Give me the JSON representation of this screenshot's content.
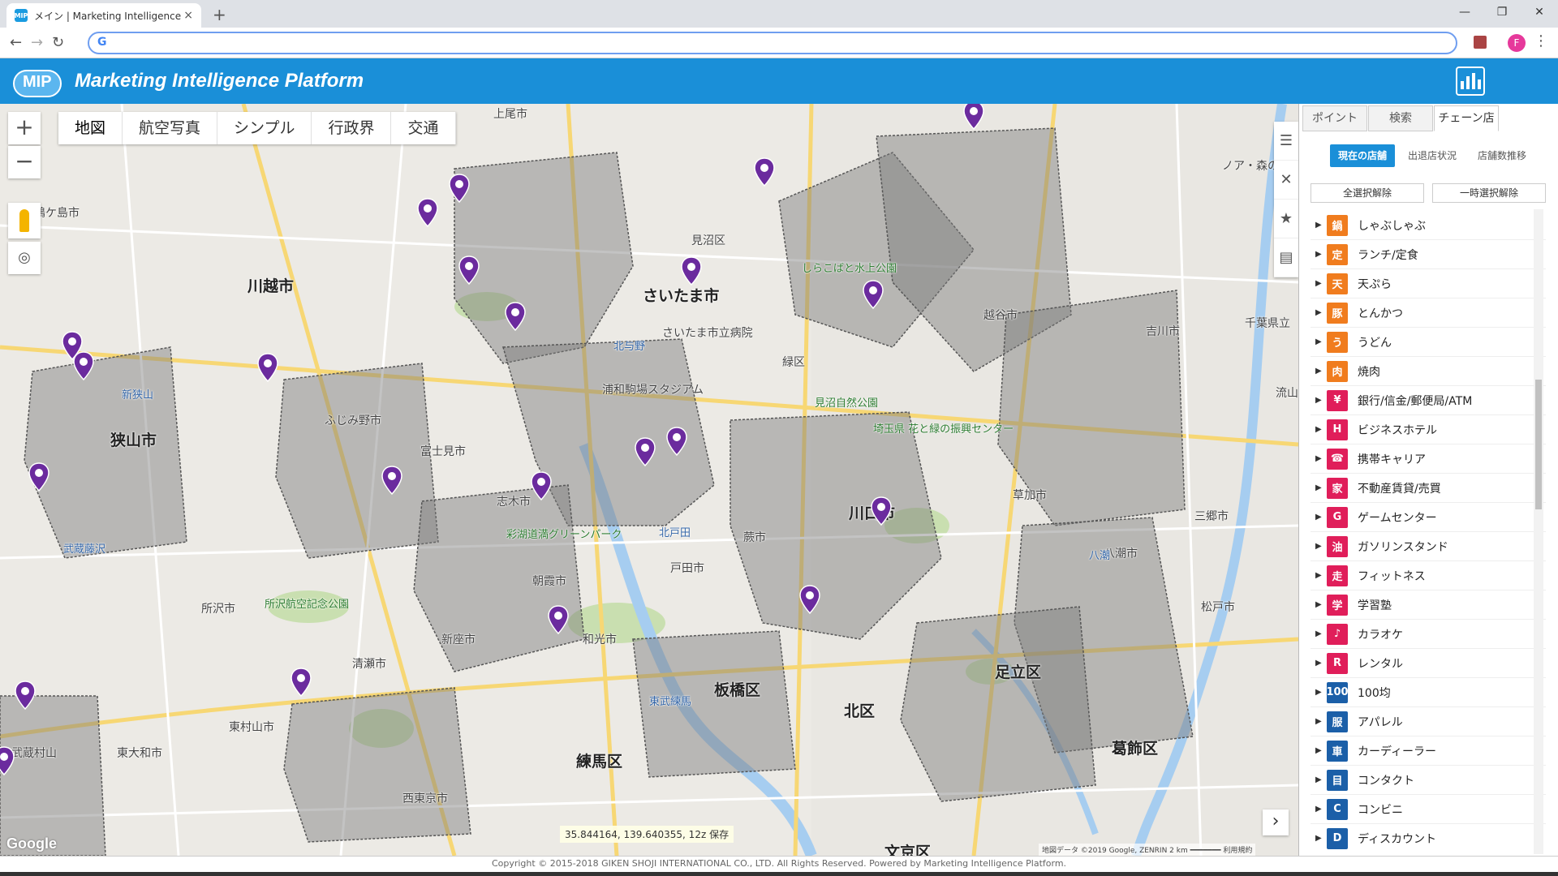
{
  "browser": {
    "tab_title": "メイン | Marketing Intelligence Pla",
    "tab_close": "×",
    "new_tab": "+",
    "window_controls": [
      "—",
      "❐",
      "✕"
    ],
    "omnibox_value": "",
    "avatar_letter": "F"
  },
  "app": {
    "logo_text": "MIP",
    "title": "Marketing Intelligence Platform"
  },
  "map": {
    "map_types": [
      "地図",
      "航空写真",
      "シンプル",
      "行政界",
      "交通"
    ],
    "zoom_in": "+",
    "zoom_out": "−",
    "coordinates": "35.844164, 139.640355, 12z",
    "save_label": "保存",
    "google_logo": "Google",
    "attribution": "地図データ ©2019 Google, ZENRIN   2 km ━━━━━━━   利用規約",
    "place_labels": [
      {
        "t": "上尾市",
        "c": "lbl"
      },
      {
        "t": "さいたま市",
        "c": "lbl big"
      },
      {
        "t": "川越市",
        "c": "lbl big"
      },
      {
        "t": "鶴ケ島市",
        "c": "lbl"
      },
      {
        "t": "狭山市",
        "c": "lbl big"
      },
      {
        "t": "ふじみ野市",
        "c": "lbl"
      },
      {
        "t": "富士見市",
        "c": "lbl"
      },
      {
        "t": "志木市",
        "c": "lbl"
      },
      {
        "t": "朝霞市",
        "c": "lbl"
      },
      {
        "t": "戸田市",
        "c": "lbl"
      },
      {
        "t": "蕨市",
        "c": "lbl"
      },
      {
        "t": "川口市",
        "c": "lbl big"
      },
      {
        "t": "草加市",
        "c": "lbl"
      },
      {
        "t": "越谷市",
        "c": "lbl"
      },
      {
        "t": "吉川市",
        "c": "lbl"
      },
      {
        "t": "三郷市",
        "c": "lbl"
      },
      {
        "t": "八潮市",
        "c": "lbl"
      },
      {
        "t": "足立区",
        "c": "lbl big"
      },
      {
        "t": "葛飾区",
        "c": "lbl big"
      },
      {
        "t": "北区",
        "c": "lbl big"
      },
      {
        "t": "板橋区",
        "c": "lbl big"
      },
      {
        "t": "練馬区",
        "c": "lbl big"
      },
      {
        "t": "和光市",
        "c": "lbl"
      },
      {
        "t": "新座市",
        "c": "lbl"
      },
      {
        "t": "清瀬市",
        "c": "lbl"
      },
      {
        "t": "所沢市",
        "c": "lbl"
      },
      {
        "t": "東村山市",
        "c": "lbl"
      },
      {
        "t": "東大和市",
        "c": "lbl"
      },
      {
        "t": "西東京市",
        "c": "lbl"
      },
      {
        "t": "文京区",
        "c": "lbl big"
      },
      {
        "t": "見沼区",
        "c": "lbl"
      },
      {
        "t": "緑区",
        "c": "lbl"
      },
      {
        "t": "武蔵藤沢",
        "c": "lbl blue"
      },
      {
        "t": "さいたま市立病院",
        "c": "lbl"
      },
      {
        "t": "所沢航空記念公園",
        "c": "lbl park"
      },
      {
        "t": "しらこばと水上公園",
        "c": "lbl park"
      },
      {
        "t": "彩湖道満グリーンパーク",
        "c": "lbl park"
      },
      {
        "t": "埼玉県 花と緑の振興センター",
        "c": "lbl park"
      },
      {
        "t": "見沼自然公園",
        "c": "lbl park"
      },
      {
        "t": "浦和駒場スタジアム",
        "c": "lbl"
      },
      {
        "t": "新狭山",
        "c": "lbl blue"
      },
      {
        "t": "北与野",
        "c": "lbl blue"
      },
      {
        "t": "北戸田",
        "c": "lbl blue"
      },
      {
        "t": "東武練馬",
        "c": "lbl blue"
      },
      {
        "t": "八潮",
        "c": "lbl blue"
      },
      {
        "t": "ノア・森の",
        "c": "lbl"
      },
      {
        "t": "千葉県立",
        "c": "lbl"
      },
      {
        "t": "流山",
        "c": "lbl"
      },
      {
        "t": "松戸市",
        "c": "lbl"
      },
      {
        "t": "武蔵村山",
        "c": "lbl"
      }
    ]
  },
  "sidebar": {
    "tabs": [
      "ポイント",
      "検索",
      "チェーン店"
    ],
    "subtabs": [
      "現在の店舗",
      "出退店状況",
      "店舗数推移"
    ],
    "select_all": "全選択解除",
    "temp_clear": "一時選択解除",
    "categories": [
      {
        "name": "しゃぶしゃぶ",
        "color": "#f07c1e",
        "glyph": "鍋"
      },
      {
        "name": "ランチ/定食",
        "color": "#f07c1e",
        "glyph": "定"
      },
      {
        "name": "天ぷら",
        "color": "#f07c1e",
        "glyph": "天"
      },
      {
        "name": "とんかつ",
        "color": "#f07c1e",
        "glyph": "豚"
      },
      {
        "name": "うどん",
        "color": "#f07c1e",
        "glyph": "う"
      },
      {
        "name": "焼肉",
        "color": "#f07c1e",
        "glyph": "肉"
      },
      {
        "name": "銀行/信金/郵便局/ATM",
        "color": "#e01e5a",
        "glyph": "¥"
      },
      {
        "name": "ビジネスホテル",
        "color": "#e01e5a",
        "glyph": "H"
      },
      {
        "name": "携帯キャリア",
        "color": "#e01e5a",
        "glyph": "☎"
      },
      {
        "name": "不動産賃貸/売買",
        "color": "#e01e5a",
        "glyph": "家"
      },
      {
        "name": "ゲームセンター",
        "color": "#e01e5a",
        "glyph": "G"
      },
      {
        "name": "ガソリンスタンド",
        "color": "#e01e5a",
        "glyph": "油"
      },
      {
        "name": "フィットネス",
        "color": "#e01e5a",
        "glyph": "走"
      },
      {
        "name": "学習塾",
        "color": "#e01e5a",
        "glyph": "学"
      },
      {
        "name": "カラオケ",
        "color": "#e01e5a",
        "glyph": "♪"
      },
      {
        "name": "レンタル",
        "color": "#e01e5a",
        "glyph": "R"
      },
      {
        "name": "100均",
        "color": "#1b5fa8",
        "glyph": "100"
      },
      {
        "name": "アパレル",
        "color": "#1b5fa8",
        "glyph": "服"
      },
      {
        "name": "カーディーラー",
        "color": "#1b5fa8",
        "glyph": "車"
      },
      {
        "name": "コンタクト",
        "color": "#1b5fa8",
        "glyph": "目"
      },
      {
        "name": "コンビニ",
        "color": "#1b5fa8",
        "glyph": "C"
      },
      {
        "name": "ディスカウント",
        "color": "#1b5fa8",
        "glyph": "D"
      }
    ]
  },
  "footer": {
    "text": "Copyright © 2015-2018 GIKEN SHOJI INTERNATIONAL CO., LTD. All Rights Reserved.  Powered by Marketing Intelligence Platform."
  },
  "colors": {
    "header_blue": "#1a8fd8",
    "pin_purple": "#6b2b9e",
    "region_fill": "#8a8a8a"
  }
}
